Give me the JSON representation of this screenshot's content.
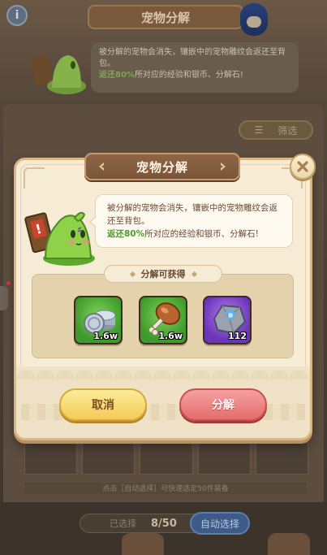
{
  "background": {
    "info_label": "i",
    "header_title": "宠物分解",
    "note_text": "被分解的宠物会消失，镶嵌中的宠物雕纹会返还至背包。",
    "note_highlight": "返还80%",
    "note_tail": "所对应的经验和银币、分解石!",
    "filter_label": "筛选",
    "hint": "点击［自动选择］可快速选定50件装备",
    "selected_label": "已选择",
    "selected_count": "8/50",
    "auto_select_label": "自动选择"
  },
  "modal": {
    "title": "宠物分解",
    "description": "被分解的宠物会消失，镶嵌中的宠物雕纹会返还至背包。",
    "highlight": "返还80%",
    "description_tail": "所对应的经验和银币、分解石!",
    "rewards_label": "分解可获得",
    "rewards": [
      {
        "icon": "silver-coins-icon",
        "quantity": "1.6w",
        "rarity_color": "#4fa83a"
      },
      {
        "icon": "meat-drumstick-icon",
        "quantity": "1.6w",
        "rarity_color": "#4fa83a"
      },
      {
        "icon": "decompose-stone-icon",
        "quantity": "112",
        "rarity_color": "#8a4fd6"
      }
    ],
    "cancel_label": "取消",
    "confirm_label": "分解"
  },
  "colors": {
    "highlight_green": "#4f9a2e",
    "cancel_yellow": "#f3cc57",
    "confirm_red": "#e56d6d",
    "title_brown": "#7a553a"
  }
}
